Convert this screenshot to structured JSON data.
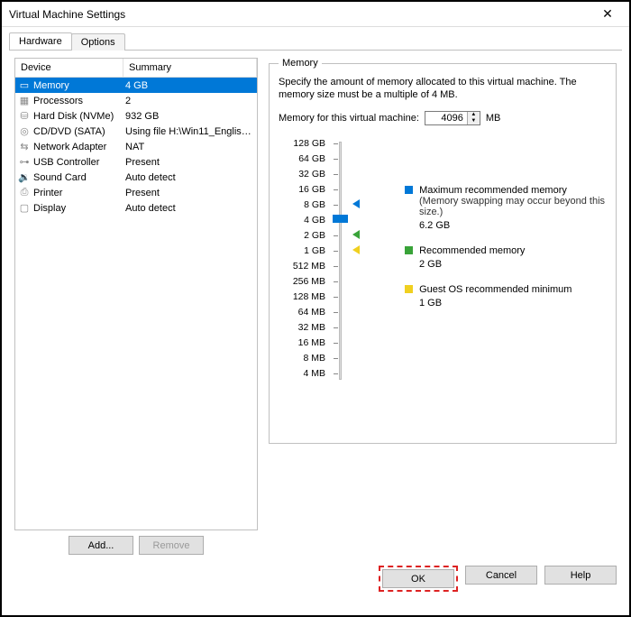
{
  "window": {
    "title": "Virtual Machine Settings"
  },
  "tabs": {
    "hardware": "Hardware",
    "options": "Options"
  },
  "list": {
    "header": {
      "device": "Device",
      "summary": "Summary"
    },
    "rows": [
      {
        "name": "Memory",
        "summary": "4 GB",
        "icon": "memory",
        "selected": true
      },
      {
        "name": "Processors",
        "summary": "2",
        "icon": "cpu"
      },
      {
        "name": "Hard Disk (NVMe)",
        "summary": "932 GB",
        "icon": "disk"
      },
      {
        "name": "CD/DVD (SATA)",
        "summary": "Using file H:\\Win11_English_...",
        "icon": "cd"
      },
      {
        "name": "Network Adapter",
        "summary": "NAT",
        "icon": "net"
      },
      {
        "name": "USB Controller",
        "summary": "Present",
        "icon": "usb"
      },
      {
        "name": "Sound Card",
        "summary": "Auto detect",
        "icon": "sound"
      },
      {
        "name": "Printer",
        "summary": "Present",
        "icon": "printer"
      },
      {
        "name": "Display",
        "summary": "Auto detect",
        "icon": "display"
      }
    ]
  },
  "list_buttons": {
    "add": "Add...",
    "remove": "Remove"
  },
  "memory": {
    "group_title": "Memory",
    "desc": "Specify the amount of memory allocated to this virtual machine. The memory size must be a multiple of 4 MB.",
    "input_label": "Memory for this virtual machine:",
    "value": "4096",
    "unit": "MB",
    "ticks": [
      "128 GB",
      "64 GB",
      "32 GB",
      "16 GB",
      "8 GB",
      "4 GB",
      "2 GB",
      "1 GB",
      "512 MB",
      "256 MB",
      "128 MB",
      "64 MB",
      "32 MB",
      "16 MB",
      "8 MB",
      "4 MB"
    ],
    "legend": {
      "max": {
        "label": "Maximum recommended memory",
        "note": "(Memory swapping may occur beyond this size.)",
        "value": "6.2 GB"
      },
      "rec": {
        "label": "Recommended memory",
        "value": "2 GB"
      },
      "min": {
        "label": "Guest OS recommended minimum",
        "value": "1 GB"
      }
    }
  },
  "dialog_buttons": {
    "ok": "OK",
    "cancel": "Cancel",
    "help": "Help"
  }
}
